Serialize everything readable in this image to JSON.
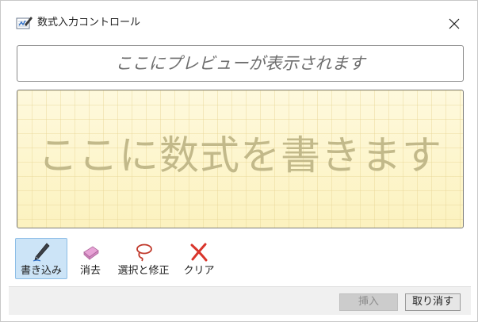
{
  "window": {
    "title": "数式入力コントロール",
    "icon": "math-input-icon",
    "close_icon": "close-icon"
  },
  "preview": {
    "placeholder": "ここにプレビューが表示されます"
  },
  "canvas": {
    "hint": "ここに数式を書きます"
  },
  "tools": [
    {
      "label": "書き込み",
      "icon": "pen-icon",
      "active": true
    },
    {
      "label": "消去",
      "icon": "eraser-icon",
      "active": false
    },
    {
      "label": "選択と修正",
      "icon": "lasso-icon",
      "active": false
    },
    {
      "label": "クリア",
      "icon": "clear-x-icon",
      "active": false
    }
  ],
  "footer": {
    "insert_label": "挿入",
    "insert_enabled": false,
    "cancel_label": "取り消す"
  },
  "colors": {
    "canvas_background": "#fdf6cf",
    "active_tool_background": "#cce4f7",
    "clear_icon": "#d9352b",
    "lasso_icon": "#c0392b",
    "eraser_icon": "#d48ac4"
  }
}
